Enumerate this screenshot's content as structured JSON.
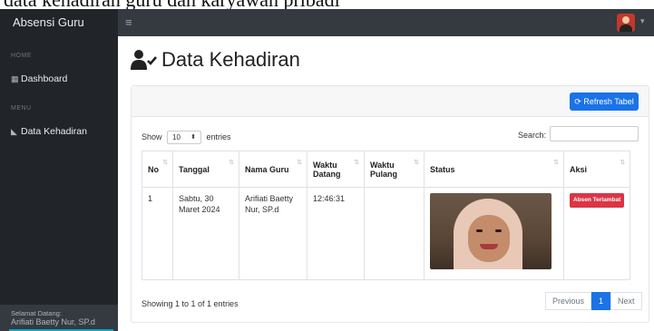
{
  "caption": {
    "text": "data kehadiran guru dan karyawan pribadi"
  },
  "navbar": {
    "brand": "Absensi Guru",
    "toggler_icon": "hamburger-icon",
    "user_icon": "user-avatar-icon"
  },
  "sidebar": {
    "heading_home": "HOME",
    "item_dashboard": "Dashboard",
    "heading_menu": "MENU",
    "item_data_kehadiran": "Data Kehadiran",
    "footer_label": "Selamat Datang:",
    "footer_user": "Arifiati Baetty Nur, SP.d"
  },
  "page": {
    "title": "Data Kehadiran",
    "title_icon": "user-check-icon"
  },
  "toolbar": {
    "refresh_label": "Refresh Tabel",
    "refresh_icon": "sync-icon"
  },
  "table_controls": {
    "show_label": "Show",
    "entries_value": "10",
    "entries_label": "entries",
    "search_label": "Search:"
  },
  "table": {
    "headers": [
      "No",
      "Tanggal",
      "Nama Guru",
      "Waktu Datang",
      "Waktu Pulang",
      "Status",
      "Aksi"
    ],
    "rows": [
      {
        "no": "1",
        "tanggal": "Sabtu, 30 Maret 2024",
        "nama": "Arifiati Baetty Nur, SP.d",
        "datang": "12:46:31",
        "pulang": "",
        "status_image": "attendance-selfie-photo",
        "aksi": "Absen Terlambat"
      }
    ]
  },
  "footer": {
    "info": "Showing 1 to 1 of 1 entries",
    "prev": "Previous",
    "page": "1",
    "next": "Next"
  },
  "colors": {
    "primary": "#1a73e8",
    "danger": "#dc3545",
    "sidebar": "#212529",
    "navbar": "#343a40"
  }
}
